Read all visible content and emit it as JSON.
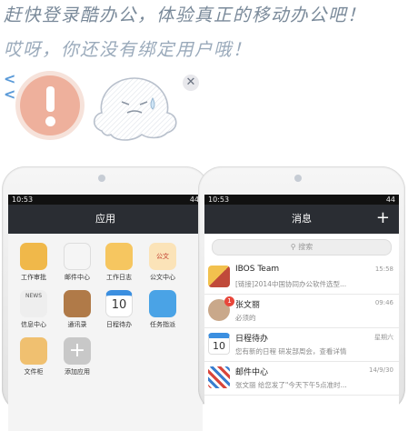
{
  "promo": {
    "line1": "赶快登录酷办公，体验真正的移动办公吧！",
    "line2": "哎呀，你还没有绑定用户哦！"
  },
  "nav_back_glyph": "<",
  "close_glyph": "✕",
  "colors": {
    "accent": "#5a9ad8",
    "warning": "#eeb09c",
    "navbar": "#2a2d33"
  },
  "phone_left": {
    "status_time": "10:53",
    "status_right": "44",
    "title": "应用",
    "apps": [
      {
        "label": "工作审批",
        "icon": "approval-icon",
        "color": "#f0b84a"
      },
      {
        "label": "邮件中心",
        "icon": "mail-icon",
        "color": "#f5f5f5"
      },
      {
        "label": "工作日志",
        "icon": "journal-icon",
        "color": "#f6c660"
      },
      {
        "label": "公文中心",
        "icon": "document-icon",
        "color": "#fbe3b8"
      },
      {
        "label": "信息中心",
        "icon": "news-icon",
        "color": "#eeeeee"
      },
      {
        "label": "通讯录",
        "icon": "contacts-icon",
        "color": "#b07a48"
      },
      {
        "label": "日程待办",
        "icon": "calendar-icon",
        "color": "#ffffff"
      },
      {
        "label": "任务指派",
        "icon": "task-icon",
        "color": "#4aa3e6"
      },
      {
        "label": "文件柜",
        "icon": "file-cabinet-icon",
        "color": "#f0c070"
      },
      {
        "label": "添加应用",
        "icon": "add-app-icon",
        "color": "#c8c8c8"
      }
    ],
    "calendar_day": "10",
    "news_tag": "NEWS",
    "doc_tag": "公文"
  },
  "phone_right": {
    "status_time": "10:53",
    "status_right": "44",
    "title": "消息",
    "plus": "+",
    "search_placeholder": "搜索",
    "messages": [
      {
        "title": "IBOS Team",
        "subtitle": "[链接]2014中国协同办公软件选型...",
        "time": "15:58"
      },
      {
        "title": "张文丽",
        "subtitle": "必须的",
        "time": "09:46",
        "badge": "1"
      },
      {
        "title": "日程待办",
        "subtitle": "您有新的日程 研发部周会，查看详情",
        "time": "星期六",
        "day": "10"
      },
      {
        "title": "邮件中心",
        "subtitle": "张文丽 给您发了\"今天下午5点准时...",
        "time": "14/9/30"
      }
    ]
  }
}
